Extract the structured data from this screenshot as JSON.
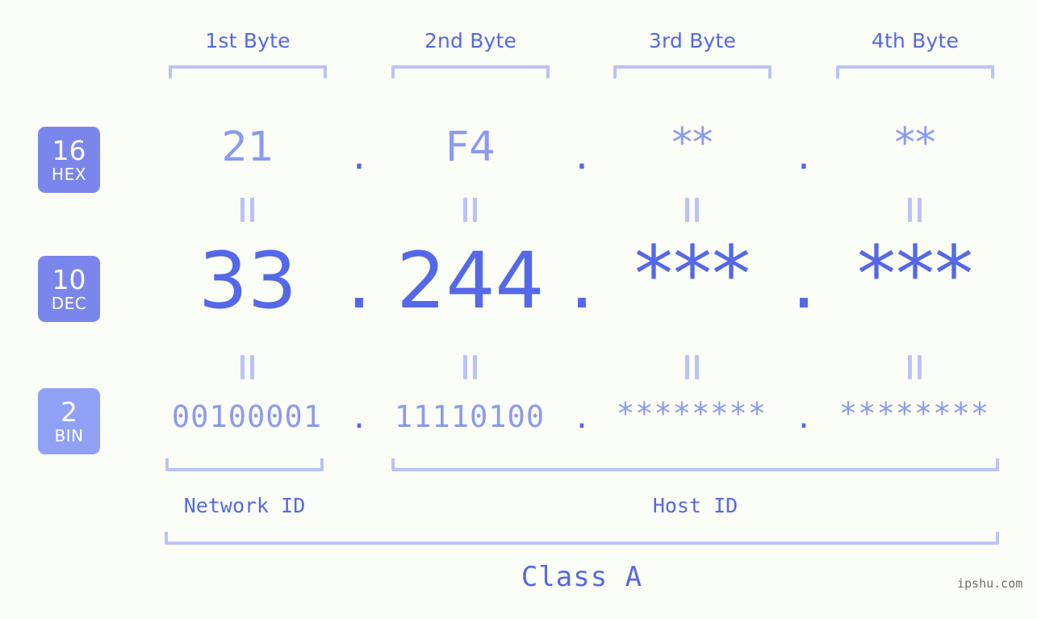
{
  "theme": {
    "background": "#fbfdf7",
    "primary_blue": "#5468e8",
    "light_blue": "#8b9af0",
    "bracket_blue": "#b9c3f7",
    "badge_blue": "#7b86ec",
    "badge_blue_light": "#8fa0f5",
    "watermark_gray": "#6e6e6e"
  },
  "byte_headers": [
    {
      "label": "1st Byte"
    },
    {
      "label": "2nd Byte"
    },
    {
      "label": "3rd Byte"
    },
    {
      "label": "4th Byte"
    }
  ],
  "bases": [
    {
      "num": "16",
      "unit": "HEX"
    },
    {
      "num": "10",
      "unit": "DEC"
    },
    {
      "num": "2",
      "unit": "BIN"
    }
  ],
  "rows": {
    "hex": {
      "base_num": "16",
      "base_unit": "HEX",
      "values": [
        "21",
        "F4",
        "**",
        "**"
      ],
      "separator": "."
    },
    "dec": {
      "base_num": "10",
      "base_unit": "DEC",
      "values": [
        "33",
        "244",
        "***",
        "***"
      ],
      "separator": "."
    },
    "bin": {
      "base_num": "2",
      "base_unit": "BIN",
      "values": [
        "00100001",
        "11110100",
        "********",
        "********"
      ],
      "separator": "."
    }
  },
  "equivalence_symbol": "=",
  "segments": {
    "network_id": "Network ID",
    "host_id": "Host ID",
    "class": "Class A"
  },
  "watermark": "ipshu.com"
}
